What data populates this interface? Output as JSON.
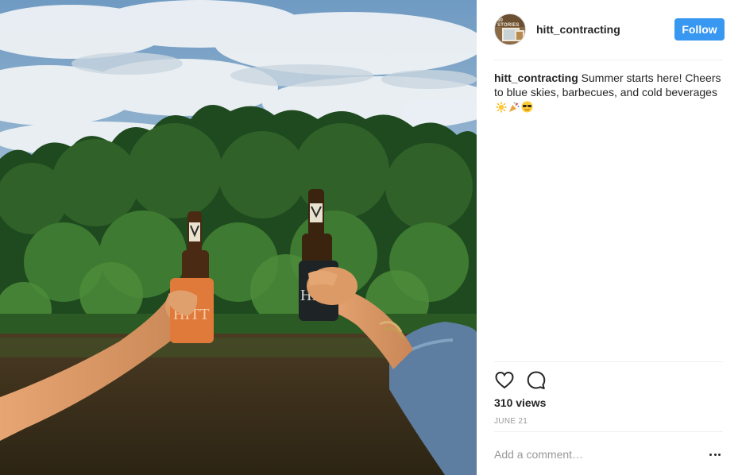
{
  "post": {
    "username": "hitt_contracting",
    "avatar_text": "80 STORIES",
    "follow_label": "Follow",
    "caption_user": "hitt_contracting",
    "caption_text": "Summer starts here! Cheers to blue skies, barbecues, and cold beverages",
    "caption_emojis": [
      "sun-emoji",
      "party-popper-emoji",
      "sunglasses-face-emoji"
    ],
    "views": "310 views",
    "date": "JUNE 21",
    "comment_placeholder": "Add a comment…",
    "photo": {
      "koozie_left_text": "HITT",
      "koozie_right_text": "HITT"
    }
  },
  "icons": {
    "like": "heart-outline-icon",
    "comment": "speech-bubble-icon",
    "more": "more-options-icon"
  },
  "colors": {
    "follow_button": "#3897f0",
    "text": "#262626",
    "muted": "#999999",
    "divider": "#efefef"
  }
}
